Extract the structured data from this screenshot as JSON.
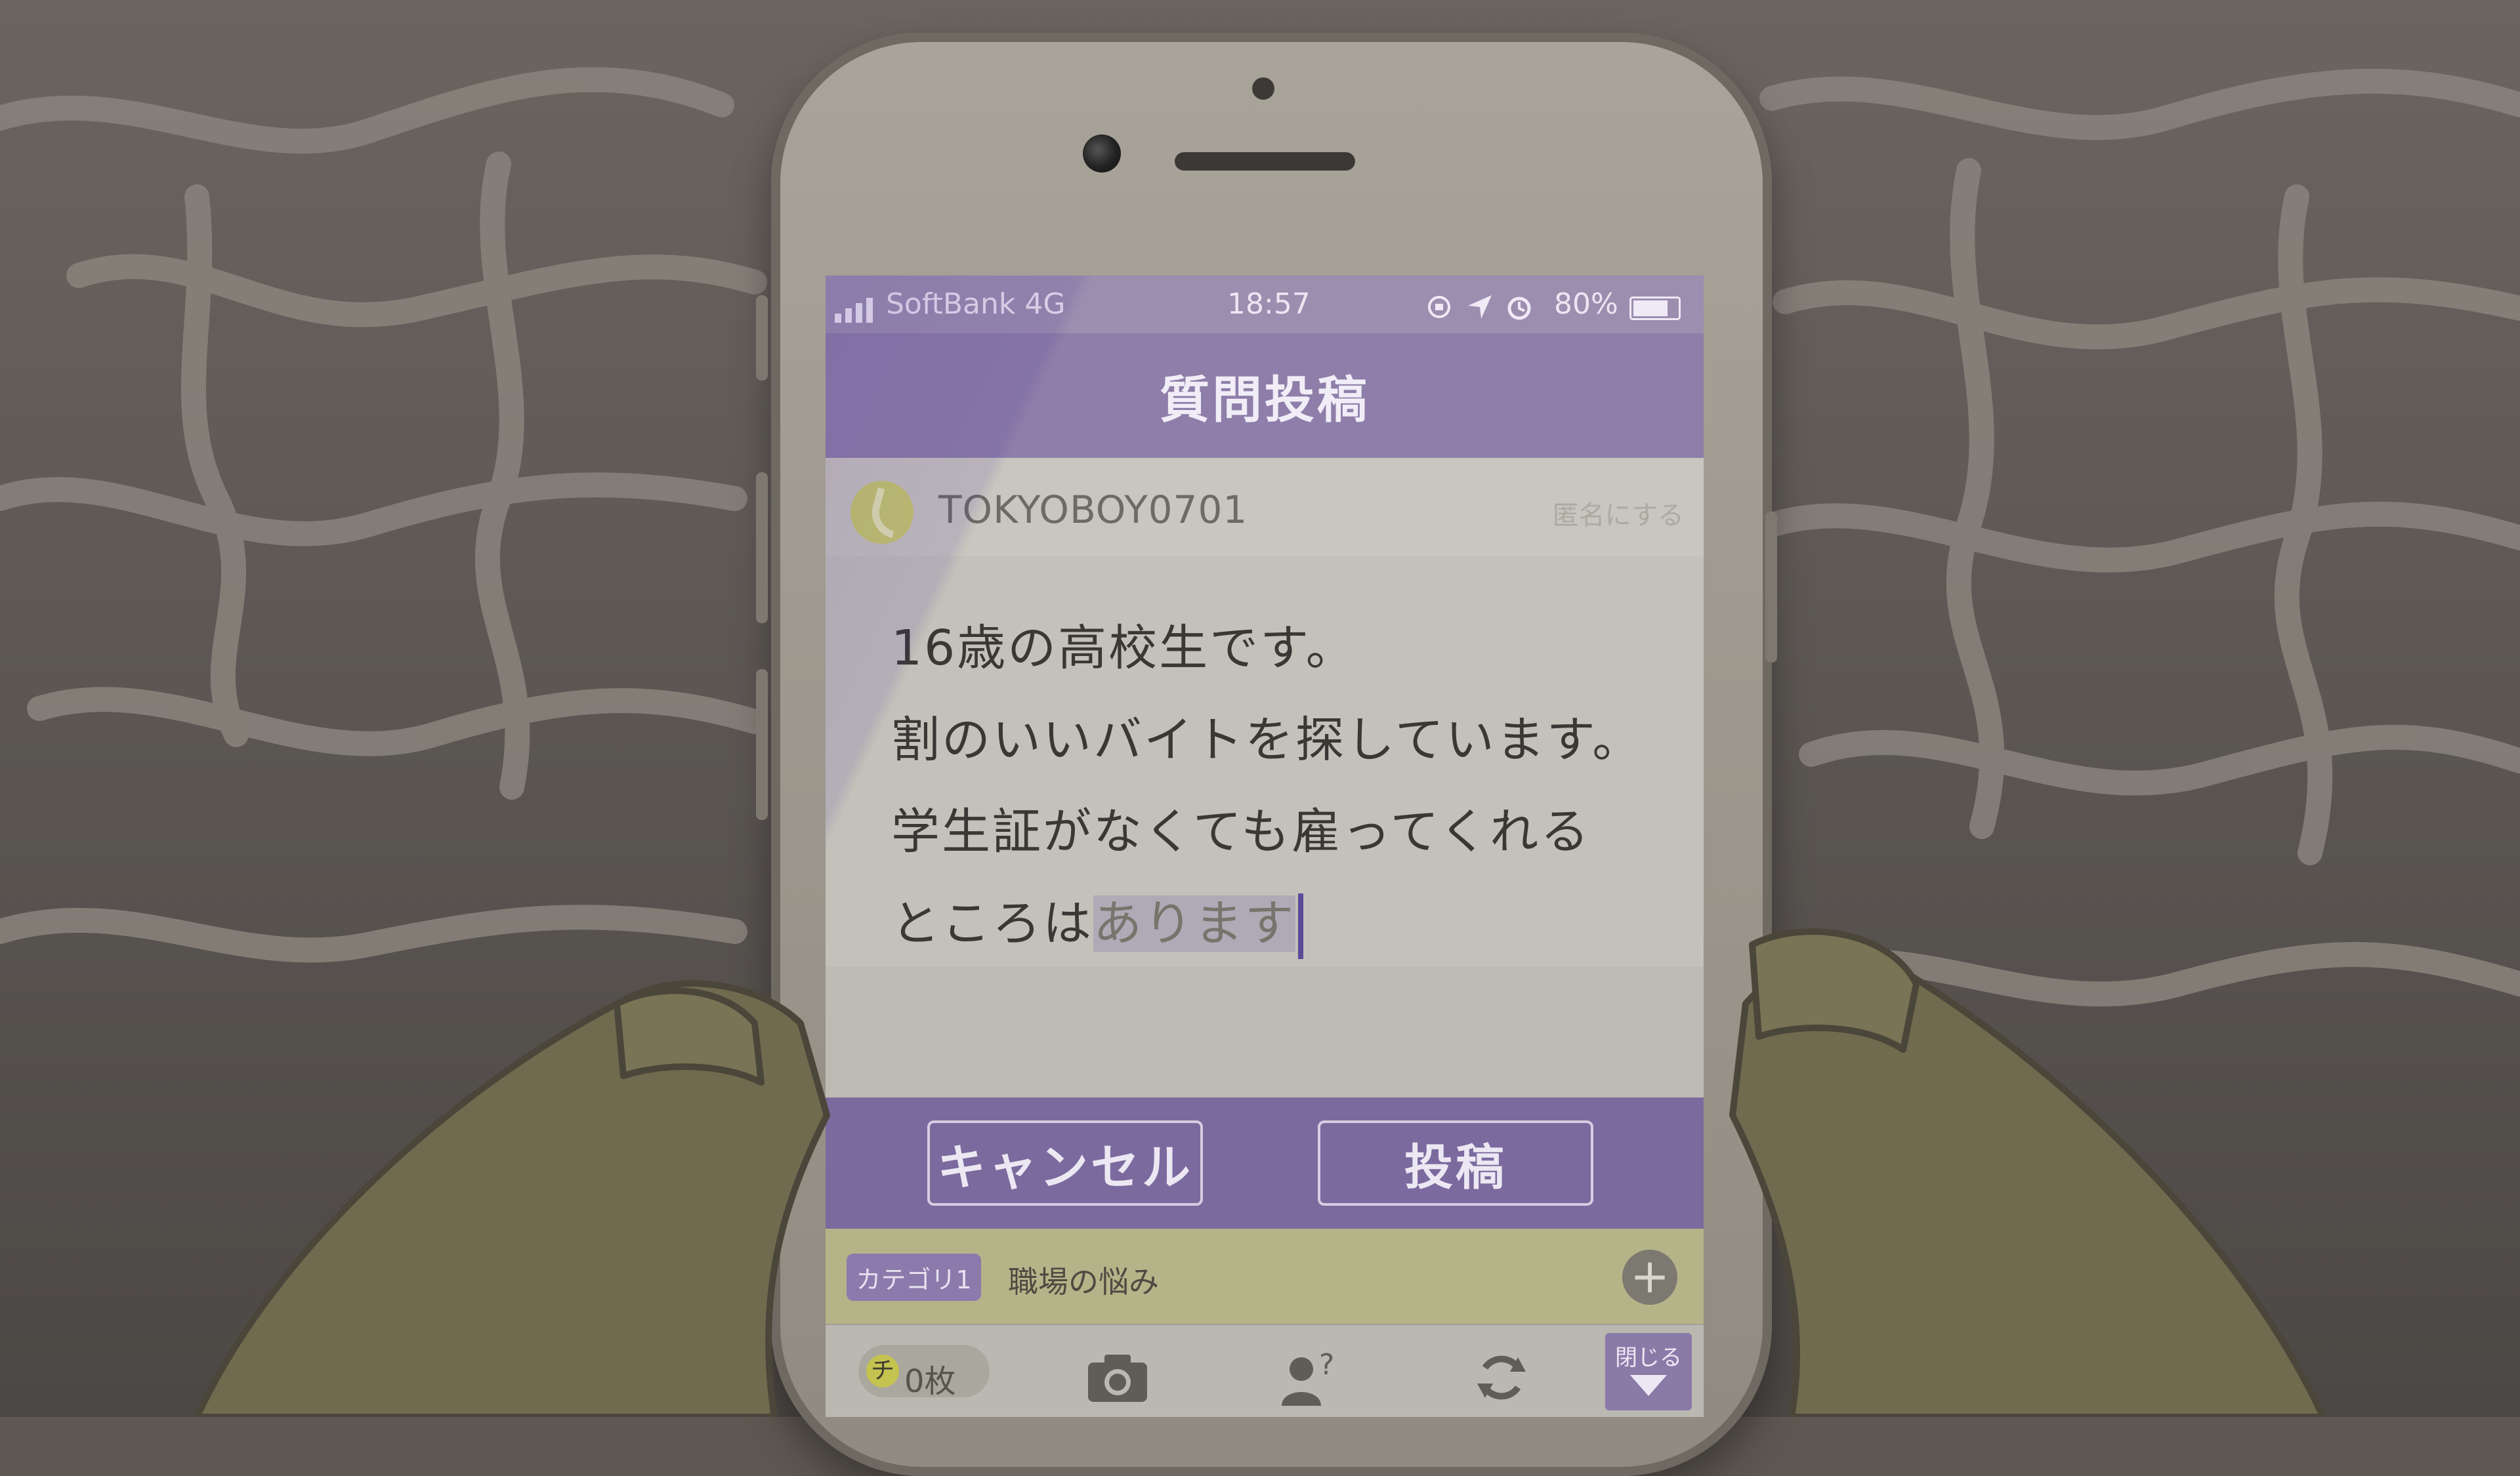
{
  "status_bar": {
    "carrier": "SoftBank 4G",
    "time": "18:57",
    "battery": "80%",
    "icons": [
      "signal-icon",
      "lock-rotation-icon",
      "location-icon",
      "alarm-icon",
      "battery-icon"
    ]
  },
  "header": {
    "title": "質問投稿"
  },
  "user": {
    "name": "TOKYOBOY0701",
    "anon_label": "匿名にする"
  },
  "question": {
    "line1": "16歳の高校生です。",
    "line2": "割のいいバイトを探しています。",
    "line3": "学生証がなくても雇ってくれる",
    "line4_committed": "ところは",
    "line4_pending": "あります"
  },
  "actions": {
    "cancel_label": "キャンセル",
    "post_label": "投稿"
  },
  "category": {
    "tag": "カテゴリ1",
    "value": "職場の悩み",
    "add_icon": "plus-icon"
  },
  "toolbar": {
    "coin_icon_glyph": "チ",
    "coin_count": "0枚",
    "camera_icon": "camera-icon",
    "user_question_icon": "user-question-icon",
    "refresh_icon": "refresh-icon",
    "close_label": "閉じる"
  },
  "colors": {
    "accent": "#8e7ea9",
    "category_bar": "#b5b489",
    "background": "#5e5852"
  }
}
